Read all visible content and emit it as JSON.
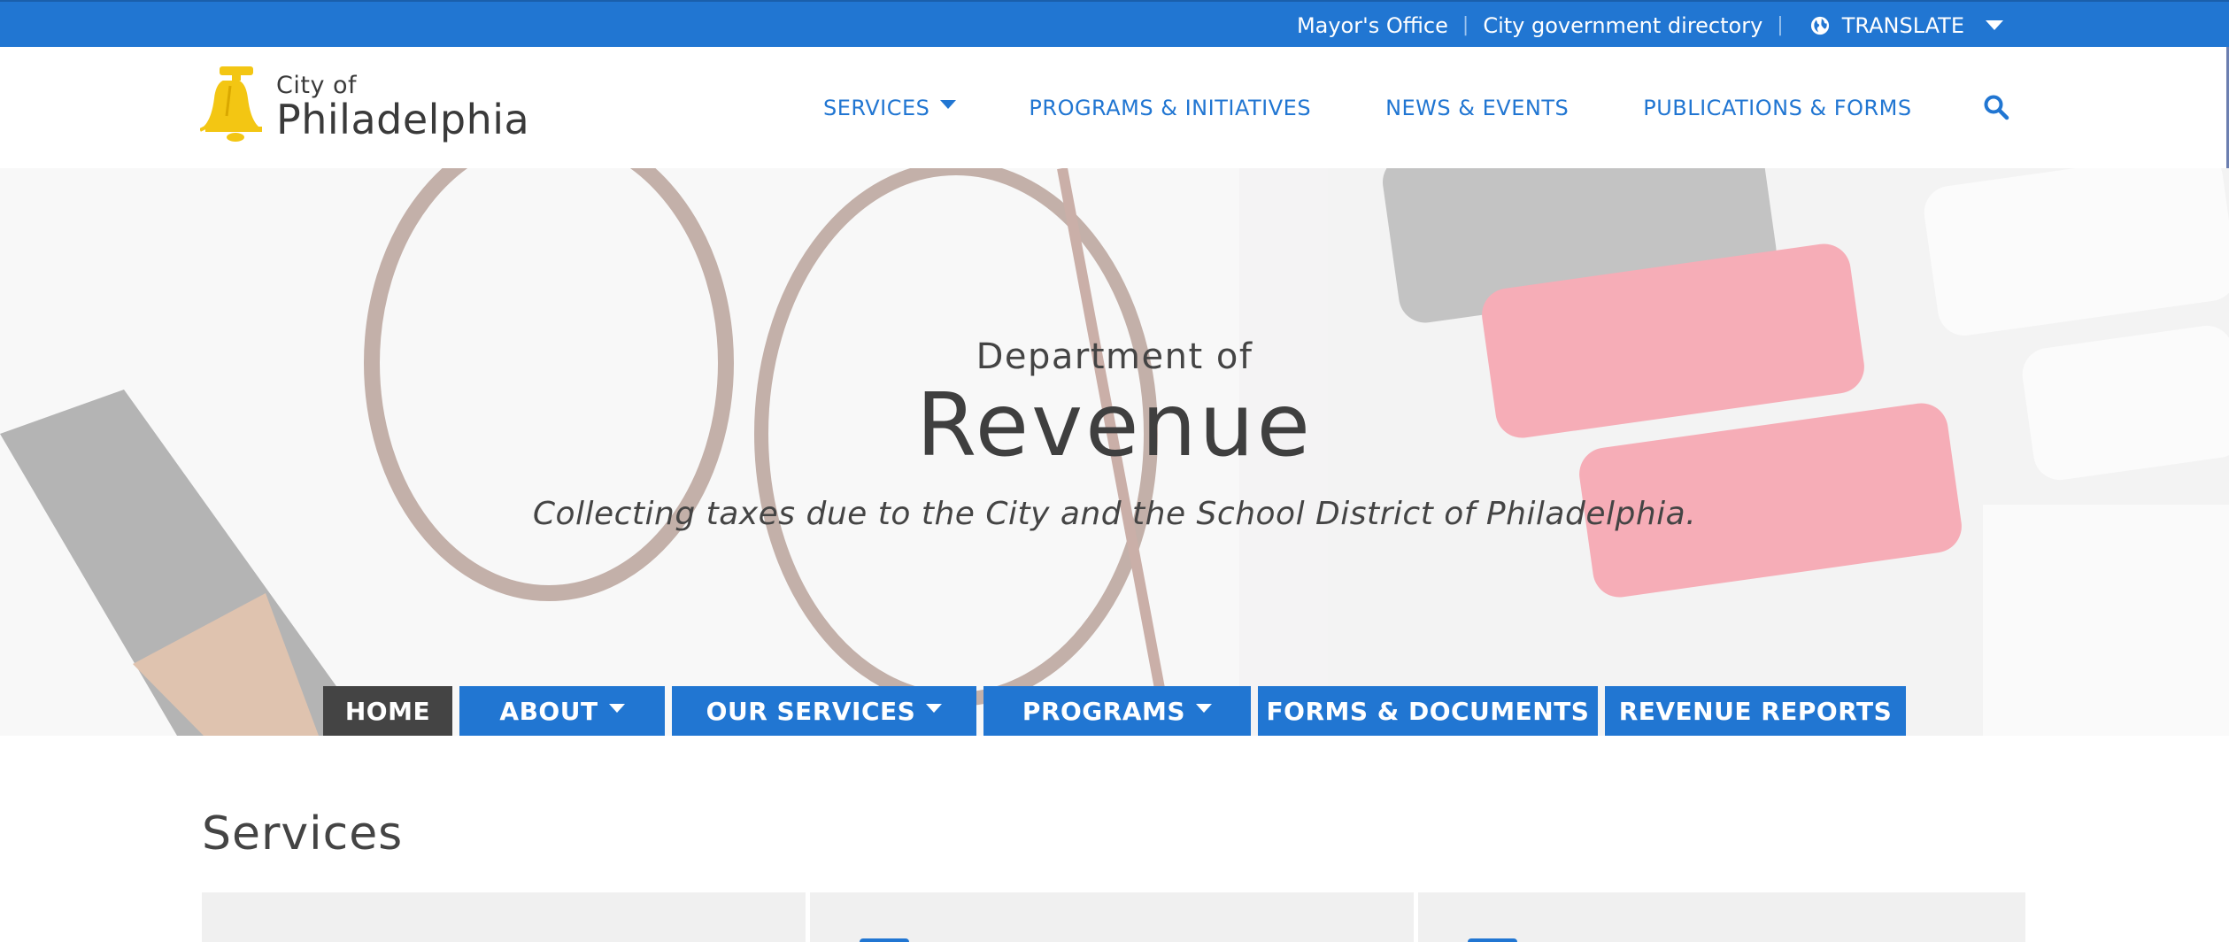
{
  "utility_bar": {
    "links": [
      "Mayor's Office",
      "City government directory"
    ],
    "translate_label": "TRANSLATE",
    "icons": {
      "globe": "globe-icon",
      "dropdown": "caret-down-icon"
    }
  },
  "logo": {
    "line1": "City of",
    "line2": "Philadelphia",
    "icon": "liberty-bell-icon"
  },
  "main_nav": {
    "items": [
      "SERVICES",
      "PROGRAMS & INITIATIVES",
      "NEWS & EVENTS",
      "PUBLICATIONS & FORMS"
    ],
    "search_icon": "search-icon"
  },
  "hero": {
    "subtitle": "Department of",
    "title": "Revenue",
    "tagline": "Collecting taxes due to the City and the School District of Philadelphia."
  },
  "dept_nav": {
    "tabs": [
      {
        "label": "HOME",
        "active": true,
        "dropdown": false
      },
      {
        "label": "ABOUT",
        "active": false,
        "dropdown": true
      },
      {
        "label": "OUR SERVICES",
        "active": false,
        "dropdown": true
      },
      {
        "label": "PROGRAMS",
        "active": false,
        "dropdown": true
      },
      {
        "label": "FORMS & DOCUMENTS",
        "active": false,
        "dropdown": false
      },
      {
        "label": "REVENUE REPORTS",
        "active": false,
        "dropdown": false
      }
    ]
  },
  "content": {
    "services_heading": "Services"
  },
  "colors": {
    "brand_blue": "#2176d2",
    "active_tab": "#444444",
    "bell_gold": "#f3c613"
  }
}
